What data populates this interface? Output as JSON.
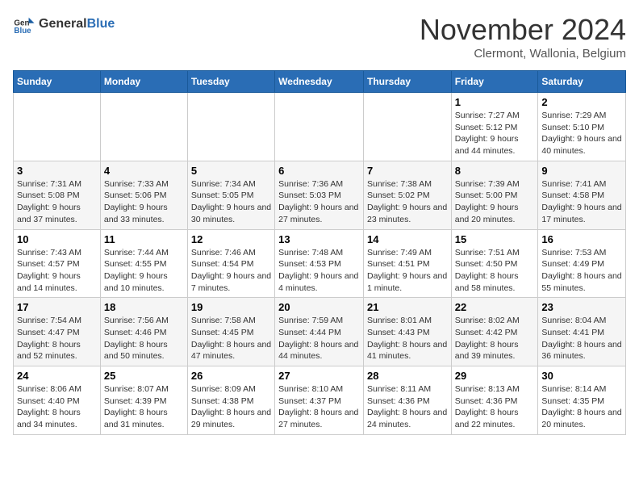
{
  "header": {
    "logo": {
      "general": "General",
      "blue": "Blue"
    },
    "title": "November 2024",
    "location": "Clermont, Wallonia, Belgium"
  },
  "calendar": {
    "days_of_week": [
      "Sunday",
      "Monday",
      "Tuesday",
      "Wednesday",
      "Thursday",
      "Friday",
      "Saturday"
    ],
    "weeks": [
      [
        {
          "day": "",
          "info": ""
        },
        {
          "day": "",
          "info": ""
        },
        {
          "day": "",
          "info": ""
        },
        {
          "day": "",
          "info": ""
        },
        {
          "day": "",
          "info": ""
        },
        {
          "day": "1",
          "info": "Sunrise: 7:27 AM\nSunset: 5:12 PM\nDaylight: 9 hours and 44 minutes."
        },
        {
          "day": "2",
          "info": "Sunrise: 7:29 AM\nSunset: 5:10 PM\nDaylight: 9 hours and 40 minutes."
        }
      ],
      [
        {
          "day": "3",
          "info": "Sunrise: 7:31 AM\nSunset: 5:08 PM\nDaylight: 9 hours and 37 minutes."
        },
        {
          "day": "4",
          "info": "Sunrise: 7:33 AM\nSunset: 5:06 PM\nDaylight: 9 hours and 33 minutes."
        },
        {
          "day": "5",
          "info": "Sunrise: 7:34 AM\nSunset: 5:05 PM\nDaylight: 9 hours and 30 minutes."
        },
        {
          "day": "6",
          "info": "Sunrise: 7:36 AM\nSunset: 5:03 PM\nDaylight: 9 hours and 27 minutes."
        },
        {
          "day": "7",
          "info": "Sunrise: 7:38 AM\nSunset: 5:02 PM\nDaylight: 9 hours and 23 minutes."
        },
        {
          "day": "8",
          "info": "Sunrise: 7:39 AM\nSunset: 5:00 PM\nDaylight: 9 hours and 20 minutes."
        },
        {
          "day": "9",
          "info": "Sunrise: 7:41 AM\nSunset: 4:58 PM\nDaylight: 9 hours and 17 minutes."
        }
      ],
      [
        {
          "day": "10",
          "info": "Sunrise: 7:43 AM\nSunset: 4:57 PM\nDaylight: 9 hours and 14 minutes."
        },
        {
          "day": "11",
          "info": "Sunrise: 7:44 AM\nSunset: 4:55 PM\nDaylight: 9 hours and 10 minutes."
        },
        {
          "day": "12",
          "info": "Sunrise: 7:46 AM\nSunset: 4:54 PM\nDaylight: 9 hours and 7 minutes."
        },
        {
          "day": "13",
          "info": "Sunrise: 7:48 AM\nSunset: 4:53 PM\nDaylight: 9 hours and 4 minutes."
        },
        {
          "day": "14",
          "info": "Sunrise: 7:49 AM\nSunset: 4:51 PM\nDaylight: 9 hours and 1 minute."
        },
        {
          "day": "15",
          "info": "Sunrise: 7:51 AM\nSunset: 4:50 PM\nDaylight: 8 hours and 58 minutes."
        },
        {
          "day": "16",
          "info": "Sunrise: 7:53 AM\nSunset: 4:49 PM\nDaylight: 8 hours and 55 minutes."
        }
      ],
      [
        {
          "day": "17",
          "info": "Sunrise: 7:54 AM\nSunset: 4:47 PM\nDaylight: 8 hours and 52 minutes."
        },
        {
          "day": "18",
          "info": "Sunrise: 7:56 AM\nSunset: 4:46 PM\nDaylight: 8 hours and 50 minutes."
        },
        {
          "day": "19",
          "info": "Sunrise: 7:58 AM\nSunset: 4:45 PM\nDaylight: 8 hours and 47 minutes."
        },
        {
          "day": "20",
          "info": "Sunrise: 7:59 AM\nSunset: 4:44 PM\nDaylight: 8 hours and 44 minutes."
        },
        {
          "day": "21",
          "info": "Sunrise: 8:01 AM\nSunset: 4:43 PM\nDaylight: 8 hours and 41 minutes."
        },
        {
          "day": "22",
          "info": "Sunrise: 8:02 AM\nSunset: 4:42 PM\nDaylight: 8 hours and 39 minutes."
        },
        {
          "day": "23",
          "info": "Sunrise: 8:04 AM\nSunset: 4:41 PM\nDaylight: 8 hours and 36 minutes."
        }
      ],
      [
        {
          "day": "24",
          "info": "Sunrise: 8:06 AM\nSunset: 4:40 PM\nDaylight: 8 hours and 34 minutes."
        },
        {
          "day": "25",
          "info": "Sunrise: 8:07 AM\nSunset: 4:39 PM\nDaylight: 8 hours and 31 minutes."
        },
        {
          "day": "26",
          "info": "Sunrise: 8:09 AM\nSunset: 4:38 PM\nDaylight: 8 hours and 29 minutes."
        },
        {
          "day": "27",
          "info": "Sunrise: 8:10 AM\nSunset: 4:37 PM\nDaylight: 8 hours and 27 minutes."
        },
        {
          "day": "28",
          "info": "Sunrise: 8:11 AM\nSunset: 4:36 PM\nDaylight: 8 hours and 24 minutes."
        },
        {
          "day": "29",
          "info": "Sunrise: 8:13 AM\nSunset: 4:36 PM\nDaylight: 8 hours and 22 minutes."
        },
        {
          "day": "30",
          "info": "Sunrise: 8:14 AM\nSunset: 4:35 PM\nDaylight: 8 hours and 20 minutes."
        }
      ]
    ]
  }
}
